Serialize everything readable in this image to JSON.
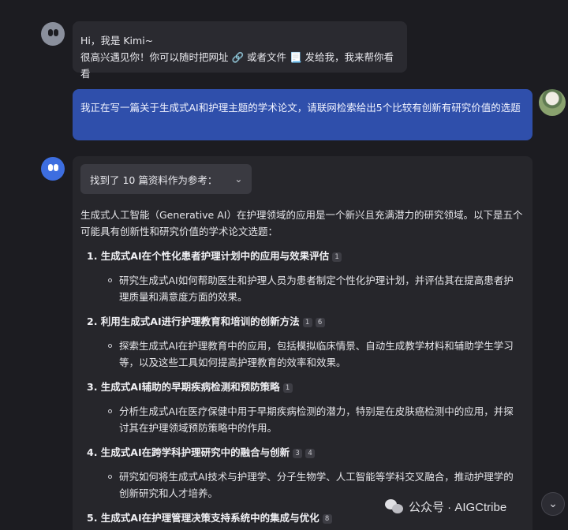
{
  "greeting": {
    "line1": "Hi，我是 Kimi~",
    "line2": "很高兴遇见你！你可以随时把网址 🔗 或者文件 📃 发给我，我来帮你看看"
  },
  "user_message": {
    "text": "我正在写一篇关于生成式AI和护理主题的学术论文，请联网检索给出5个比较有创新有研究价值的选题"
  },
  "answer": {
    "references_label": "找到了 10 篇资料作为参考：",
    "intro": "生成式人工智能（Generative AI）在护理领域的应用是一个新兴且充满潜力的研究领域。以下是五个可能具有创新性和研究价值的学术论文选题：",
    "items": [
      {
        "title": "1. 生成式AI在个性化患者护理计划中的应用与效果评估",
        "cites": [
          "1"
        ],
        "desc": "研究生成式AI如何帮助医生和护理人员为患者制定个性化护理计划，并评估其在提高患者护理质量和满意度方面的效果。"
      },
      {
        "title": "2. 利用生成式AI进行护理教育和培训的创新方法",
        "cites": [
          "1",
          "6"
        ],
        "desc": "探索生成式AI在护理教育中的应用，包括模拟临床情景、自动生成教学材料和辅助学生学习等，以及这些工具如何提高护理教育的效率和效果。"
      },
      {
        "title": "3. 生成式AI辅助的早期疾病检测和预防策略",
        "cites": [
          "1"
        ],
        "desc": "分析生成式AI在医疗保健中用于早期疾病检测的潜力，特别是在皮肤癌检测中的应用，并探讨其在护理领域预防策略中的作用。"
      },
      {
        "title": "4. 生成式AI在跨学科护理研究中的融合与创新",
        "cites": [
          "3",
          "4"
        ],
        "desc": "研究如何将生成式AI技术与护理学、分子生物学、人工智能等学科交叉融合，推动护理学的创新研究和人才培养。"
      },
      {
        "title": "5. 生成式AI在护理管理决策支持系统中的集成与优化",
        "cites": [
          "8"
        ],
        "desc": ""
      }
    ]
  },
  "watermark": {
    "text": "公众号 · AIGCtribe"
  },
  "icons": {
    "bot": "kimi-avatar-icon",
    "chevron": "chevron-down-icon",
    "scroll": "scroll-down-icon",
    "wechat": "wechat-logo-icon"
  },
  "colors": {
    "background": "#1c1c21",
    "user_bubble": "#2f4fab",
    "bot_bubble": "#2a2a30",
    "answer_panel": "#26262b"
  }
}
